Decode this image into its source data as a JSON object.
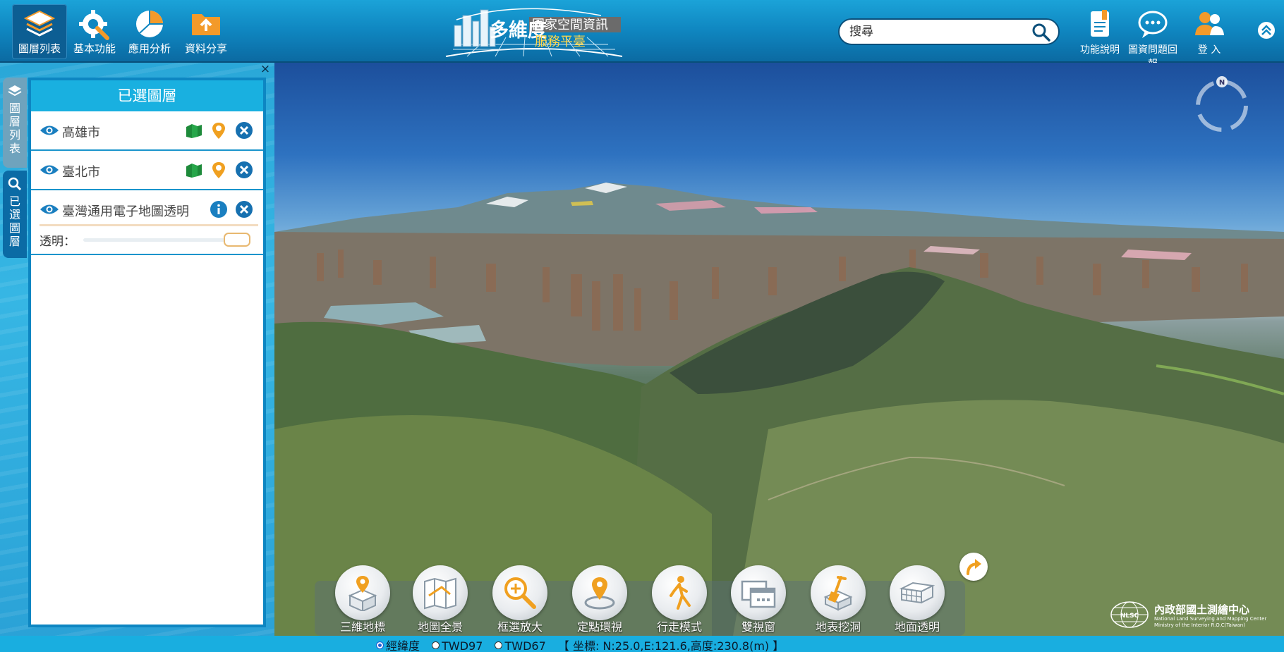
{
  "topbar": {
    "buttons": [
      {
        "label": "圖層列表",
        "icon": "layers-icon",
        "active": true
      },
      {
        "label": "基本功能",
        "icon": "gear-wrench-icon",
        "active": false
      },
      {
        "label": "應用分析",
        "icon": "pie-chart-icon",
        "active": false
      },
      {
        "label": "資料分享",
        "icon": "upload-folder-icon",
        "active": false
      }
    ],
    "logo": {
      "big": "多維度",
      "line1": "國家空間資訊",
      "line2": "服務平臺"
    },
    "search_placeholder": "搜尋",
    "right_buttons": [
      {
        "label": "功能說明",
        "icon": "book-icon"
      },
      {
        "label": "圖資問題回報",
        "icon": "chat-icon"
      },
      {
        "label": "登 入",
        "icon": "users-icon"
      }
    ]
  },
  "side_tabs": {
    "list": "圖層列表",
    "selected": "已選圖層"
  },
  "panel": {
    "close": "×",
    "title": "已選圖層",
    "layers": [
      {
        "name": "高雄市"
      },
      {
        "name": "臺北市"
      },
      {
        "name": "臺灣通用電子地圖透明"
      }
    ],
    "opacity_label": "透明："
  },
  "tools": [
    {
      "label": "三維地標",
      "icon": "landmark-3d-icon"
    },
    {
      "label": "地圖全景",
      "icon": "map-panorama-icon"
    },
    {
      "label": "框選放大",
      "icon": "zoom-box-icon"
    },
    {
      "label": "定點環視",
      "icon": "point-orbit-icon"
    },
    {
      "label": "行走模式",
      "icon": "walk-icon"
    },
    {
      "label": "雙視窗",
      "icon": "dual-window-icon"
    },
    {
      "label": "地表挖洞",
      "icon": "dig-shovel-icon"
    },
    {
      "label": "地面透明",
      "icon": "ground-transparent-icon"
    }
  ],
  "agency": {
    "name": "內政部國土測繪中心",
    "en1": "National Land Surveying and Mapping Center",
    "en2": "Ministry of the Interior  R.O.C(Taiwan)",
    "badge": "NLSC"
  },
  "statusbar": {
    "options": [
      "經緯度",
      "TWD97",
      "TWD67"
    ],
    "selected": "經緯度",
    "coords": "【 坐標: N:25.0,E:121.6,高度:230.8(m) 】"
  },
  "compass_label": "N",
  "colors": {
    "topbar": "#0f86c0",
    "panel_title": "#19b0e0",
    "accent_blue": "#0d86c2",
    "eye": "#1a7fc0",
    "green_icon": "#1d8a3a",
    "pin_orange": "#f0a020",
    "remove_blue": "#1670b0"
  }
}
